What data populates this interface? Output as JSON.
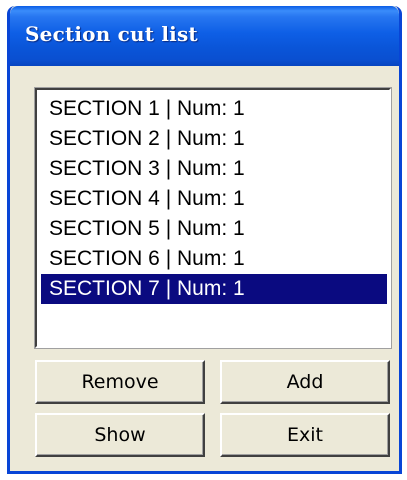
{
  "window": {
    "title": "Section cut list"
  },
  "list": {
    "items": [
      "SECTION 1 | Num: 1",
      "SECTION 2 | Num: 1",
      "SECTION 3 | Num: 1",
      "SECTION 4 | Num: 1",
      "SECTION 5 | Num: 1",
      "SECTION 6 | Num: 1",
      "SECTION 7 | Num: 1"
    ],
    "selected_item": "SECTION 7 | Num: 1"
  },
  "buttons": {
    "remove_label": "Remove",
    "add_label": "Add",
    "show_label": "Show",
    "exit_label": "Exit"
  },
  "colors": {
    "titlebar": "#0a55d8",
    "selection": "#0a0a80",
    "face": "#ece9d8"
  }
}
